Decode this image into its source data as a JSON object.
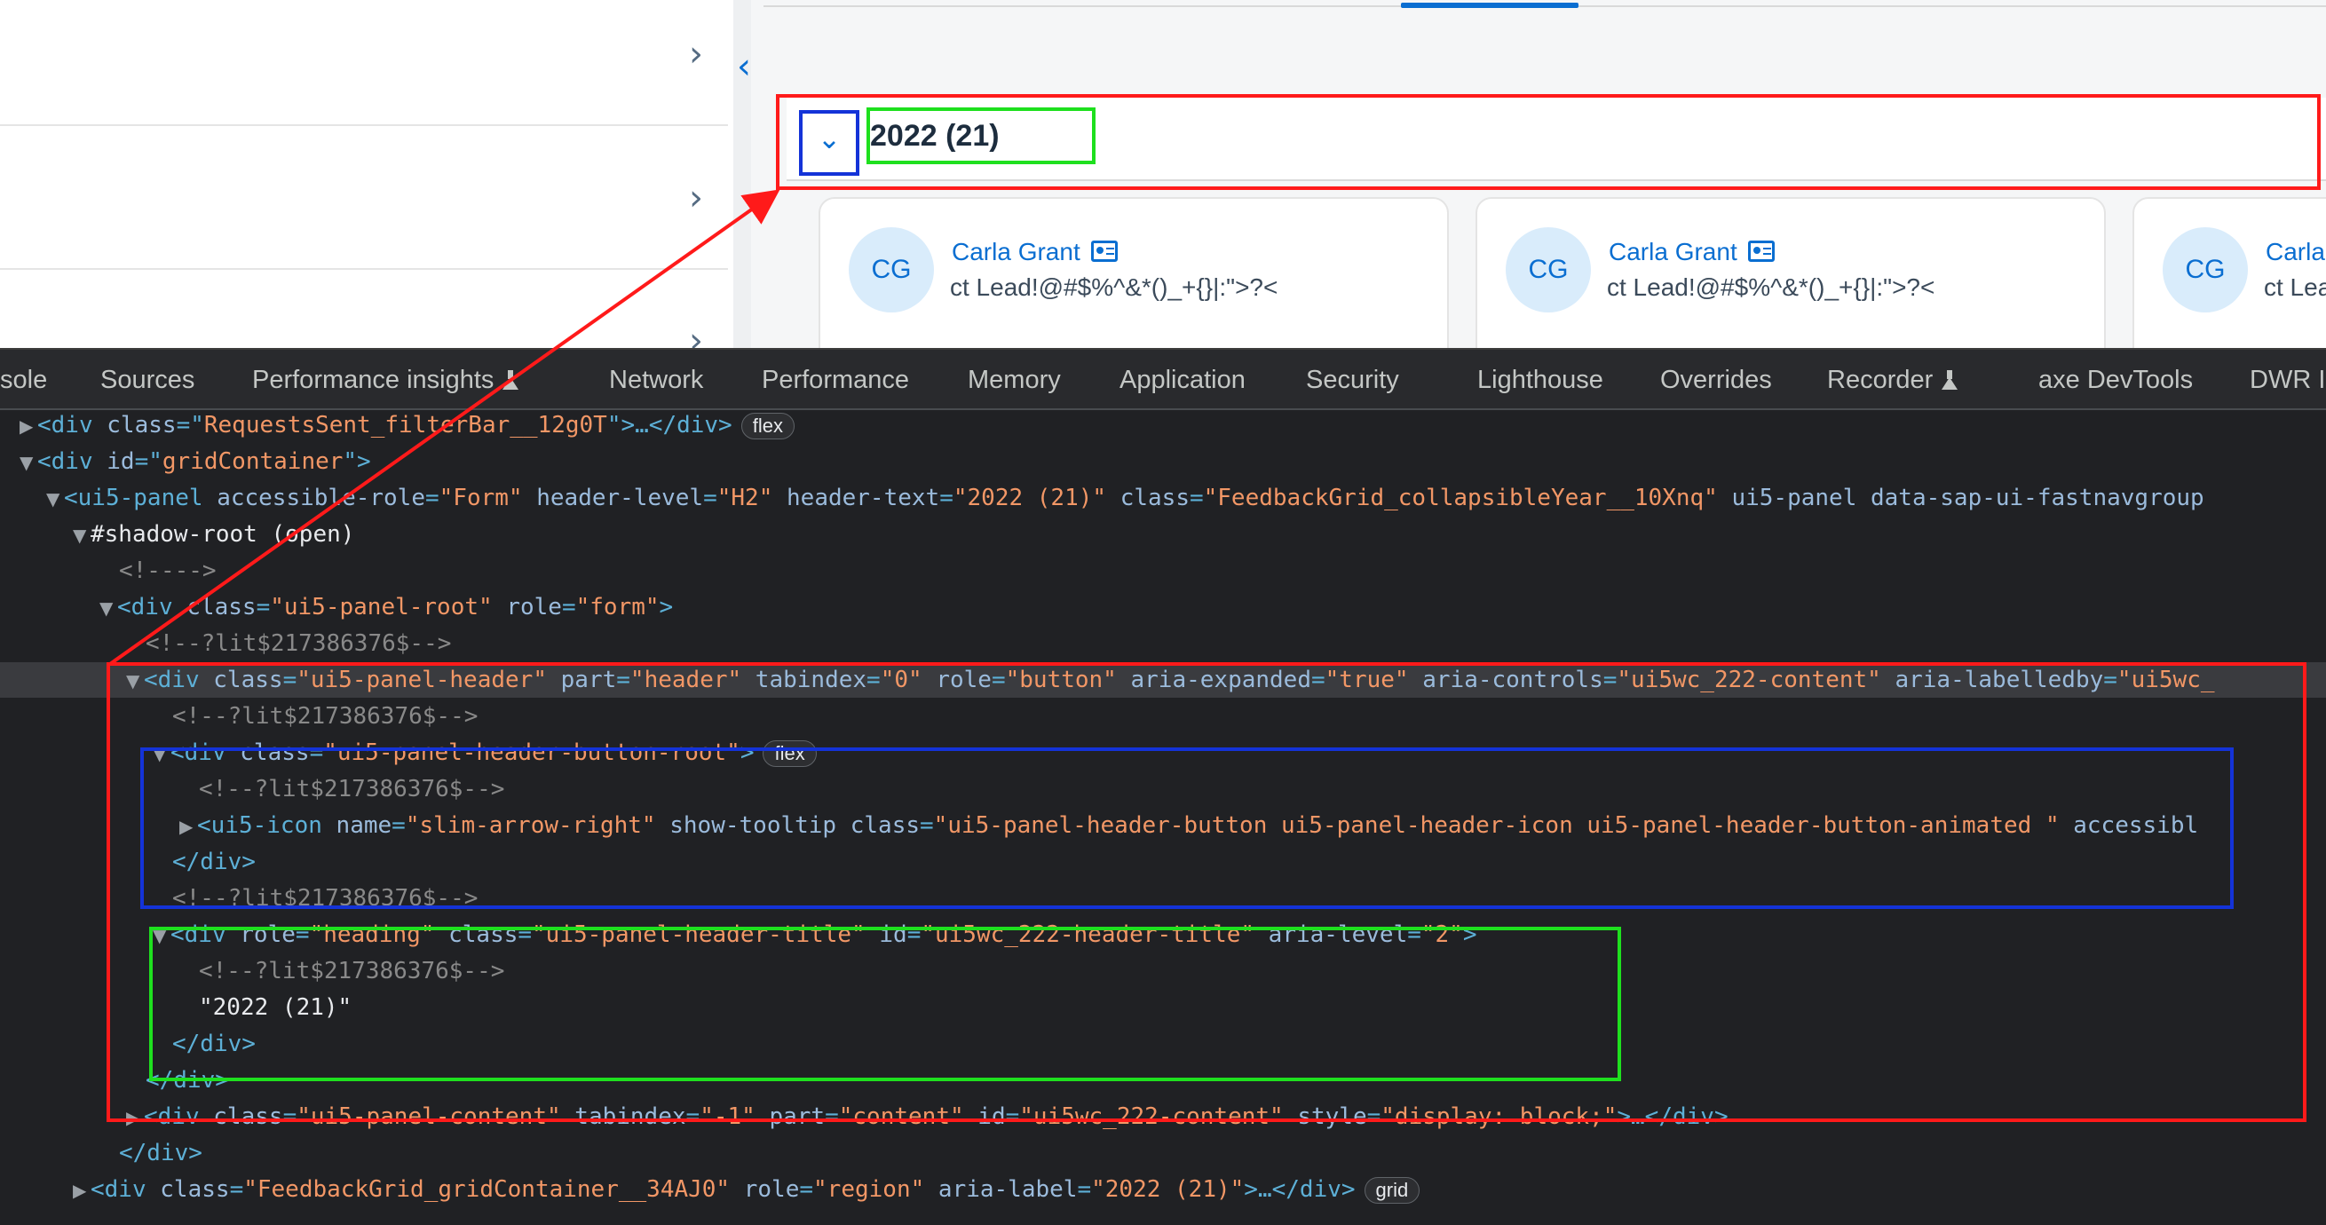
{
  "app": {
    "panel": {
      "toggle_icon": "chevron-down-icon",
      "title": "2022 (21)"
    },
    "cards": [
      {
        "initials": "CG",
        "name": "Carla Grant",
        "subtitle": "ct Lead!@#$%^&*()_+{}|:\">?<"
      },
      {
        "initials": "CG",
        "name": "Carla Grant",
        "subtitle": "ct Lead!@#$%^&*()_+{}|:\">?<"
      },
      {
        "initials": "CG",
        "name": "Carla",
        "subtitle": "ct Lea"
      }
    ]
  },
  "devtools": {
    "tabs": [
      "sole",
      "Sources",
      "Performance insights",
      "Network",
      "Performance",
      "Memory",
      "Application",
      "Security",
      "Lighthouse",
      "Overrides",
      "Recorder",
      "axe DevTools",
      "DWR I"
    ],
    "badges": {
      "flex": "flex",
      "grid": "grid"
    },
    "dom": {
      "l0": {
        "t1": "<div ",
        "a1": "class",
        "e1": "=\"",
        "v1": "RequestsSent_filterBar__12g0T",
        "t2": "\">…</div>"
      },
      "l1": {
        "t1": "<div ",
        "a1": "id",
        "e1": "=\"",
        "v1": "gridContainer",
        "t2": "\">"
      },
      "l2": {
        "t1": "<ui5-panel ",
        "a1": "accessible-role",
        "v1": "\"Form\"",
        "a2": " header-level",
        "v2": "\"H2\"",
        "a3": " header-text",
        "v3": "\"2022 (21)\"",
        "a4": " class",
        "v4": "\"FeedbackGrid_collapsibleYear__10Xnq\"",
        "a5": " ui5-panel data-sap-ui-fastnavgroup"
      },
      "l3": {
        "text": "#shadow-root (open)"
      },
      "l4": {
        "text": "<!---->"
      },
      "l5": {
        "t1": "<div ",
        "a1": "class",
        "v1": "\"ui5-panel-root\"",
        "a2": " role",
        "v2": "\"form\"",
        "t2": ">"
      },
      "l6": {
        "text": "<!--?lit$217386376$-->"
      },
      "l7": {
        "t1": "<div ",
        "a1": "class",
        "v1": "\"ui5-panel-header\"",
        "a2": " part",
        "v2": "\"header\"",
        "a3": " tabindex",
        "v3": "\"0\"",
        "a4": " role",
        "v4": "\"button\"",
        "a5": " aria-expanded",
        "v5": "\"true\"",
        "a6": " aria-controls",
        "v6": "\"ui5wc_222-content\"",
        "a7": " aria-labelledby",
        "v7": "\"ui5wc_"
      },
      "l8": {
        "text": "<!--?lit$217386376$-->"
      },
      "l9": {
        "t1": "<div ",
        "a1": "class",
        "v1": "\"ui5-panel-header-button-root\"",
        "t2": ">"
      },
      "l10": {
        "text": "<!--?lit$217386376$-->"
      },
      "l11": {
        "t1": "<ui5-icon ",
        "a1": "name",
        "v1": "\"slim-arrow-right\"",
        "a2": " show-tooltip class",
        "v2": "\"ui5-panel-header-button ui5-panel-header-icon  ui5-panel-header-button-animated \"",
        "a3": " accessibl"
      },
      "l12": {
        "text": "</div>"
      },
      "l13": {
        "text": "<!--?lit$217386376$-->"
      },
      "l14": {
        "t1": "<div ",
        "a1": "role",
        "v1": "\"heading\"",
        "a2": " class",
        "v2": "\"ui5-panel-header-title\"",
        "a3": " id",
        "v3": "\"ui5wc_222-header-title\"",
        "a4": " aria-level",
        "v4": "\"2\"",
        "t2": ">"
      },
      "l15": {
        "text": "<!--?lit$217386376$-->"
      },
      "l16": {
        "text": "\"2022 (21)\""
      },
      "l17": {
        "text": "</div>"
      },
      "l18": {
        "text": "</div>"
      },
      "l19": {
        "t1": "<div ",
        "a1": "class",
        "v1": "\"ui5-panel-content\"",
        "a2": " tabindex",
        "v2": "\"-1\"",
        "a3": " part",
        "v3": "\"content\"",
        "a4": " id",
        "v4": "\"ui5wc_222-content\"",
        "a5": " style",
        "v5": "\"display: block;\"",
        "t2": ">…</div>"
      },
      "l20": {
        "text": "</div>"
      },
      "l21": {
        "t1": "<div ",
        "a1": "class",
        "v1": "\"FeedbackGrid_gridContainer__34AJ0\"",
        "a2": " role",
        "v2": "\"region\"",
        "a3": " aria-label",
        "v3": "\"2022 (21)\"",
        "t2": ">…</div>"
      }
    }
  },
  "annotation_colors": {
    "red": "#ff1a1a",
    "blue": "#1433d8",
    "green": "#1ee01e"
  }
}
